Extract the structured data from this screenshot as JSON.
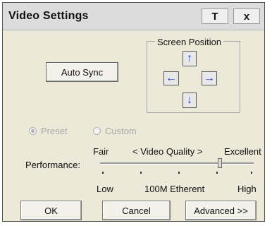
{
  "window": {
    "title": "Video Settings",
    "help_button": "T",
    "close_button": "x"
  },
  "auto_sync_label": "Auto Sync",
  "screen_position": {
    "legend": "Screen Position",
    "up": "↑",
    "left": "←",
    "right": "→",
    "down": "↓"
  },
  "mode": {
    "preset_label": "Preset",
    "custom_label": "Custom",
    "selected": "Preset",
    "enabled": false
  },
  "performance": {
    "label": "Performance:",
    "top_left": "Fair",
    "top_center": "< Video Quality >",
    "top_right": "Excellent",
    "bottom_left": "Low",
    "bottom_center": "100M Etherent",
    "bottom_right": "High",
    "slider_value": 0.78
  },
  "buttons": {
    "ok": "OK",
    "cancel": "Cancel",
    "advanced": "Advanced >>"
  }
}
